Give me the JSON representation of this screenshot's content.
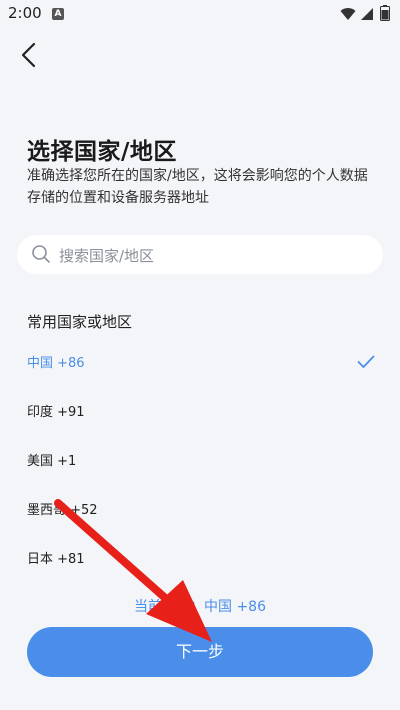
{
  "status_bar": {
    "time": "2:00",
    "app_icon_letter": "A"
  },
  "header": {
    "title": "选择国家/地区",
    "description": "准确选择您所在的国家/地区，这将会影响您的个人数据存储的位置和设备服务器地址"
  },
  "search": {
    "placeholder": "搜索国家/地区"
  },
  "section": {
    "heading": "常用国家或地区"
  },
  "countries": [
    {
      "label": "中国 +86",
      "selected": true
    },
    {
      "label": "印度 +91",
      "selected": false
    },
    {
      "label": "美国 +1",
      "selected": false
    },
    {
      "label": "墨西哥 +52",
      "selected": false
    },
    {
      "label": "日本 +81",
      "selected": false
    }
  ],
  "footer": {
    "current_selection": "当前选择：中国 +86",
    "next_label": "下一步"
  },
  "colors": {
    "accent": "#4a8eea",
    "background": "#f4f5f8",
    "annotation_arrow": "#e8201a"
  },
  "icons": {
    "back": "chevron-left-icon",
    "search": "search-icon",
    "check": "check-icon",
    "wifi": "wifi-icon",
    "signal": "signal-icon",
    "battery": "battery-icon"
  }
}
